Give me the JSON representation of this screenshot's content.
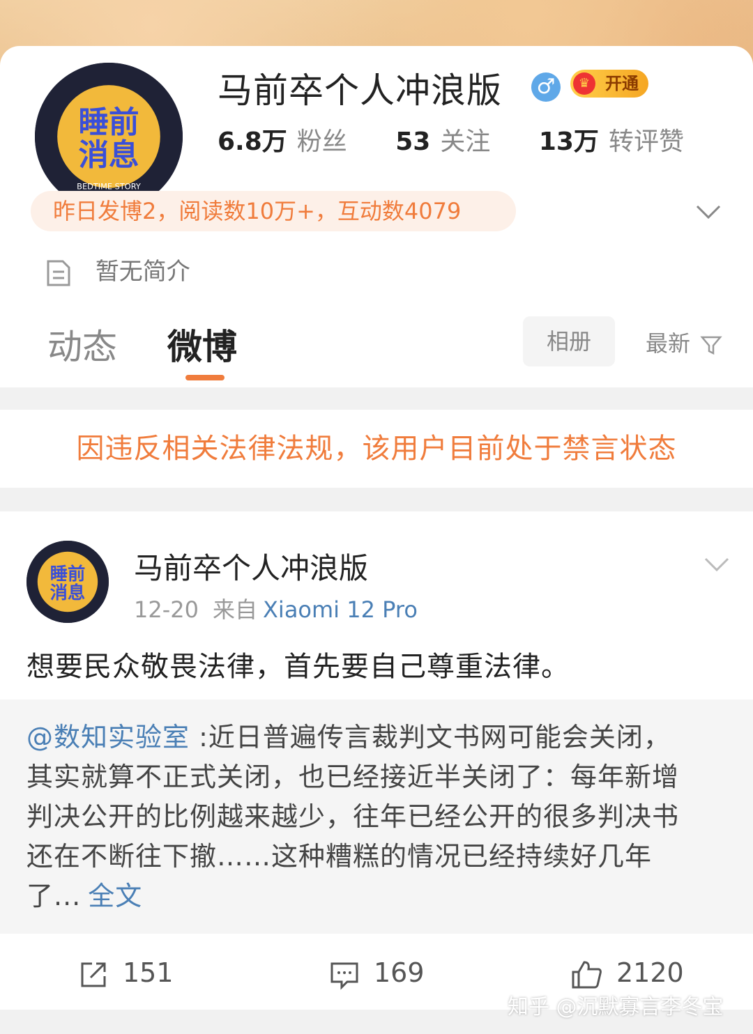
{
  "profile": {
    "username": "马前卒个人冲浪版",
    "gender_symbol": "♂",
    "vip_label": "开通",
    "avatar_text_line1": "睡前",
    "avatar_text_line2": "消息",
    "avatar_subtext": "BEDTIME STORY",
    "stats": [
      {
        "value": "6.8万",
        "label": "粉丝"
      },
      {
        "value": "53",
        "label": "关注"
      },
      {
        "value": "13万",
        "label": "转评赞"
      }
    ],
    "activity_summary": "昨日发博2，阅读数10万+，互动数4079",
    "bio": "暂无简介"
  },
  "tabs": [
    {
      "label": "动态",
      "active": false
    },
    {
      "label": "微博",
      "active": true
    }
  ],
  "toolbar": {
    "album_label": "相册",
    "sort_label": "最新"
  },
  "notice": "因违反相关法律法规，该用户目前处于禁言状态",
  "post": {
    "author": "马前卒个人冲浪版",
    "date": "12-20",
    "source_prefix": "来自",
    "device": "Xiaomi 12 Pro",
    "text": "想要民众敬畏法律，首先要自己尊重法律。",
    "repost": {
      "mention": "@数知实验室",
      "line1": " :近日普遍传言裁判文书网可能会关闭，",
      "line2": "其实就算不正式关闭，也已经接近半关闭了：每年新增",
      "line3": "判决公开的比例越来越少，往年已经公开的很多判决书",
      "line4": "还在不断往下撤……这种糟糕的情况已经持续好几年",
      "line5": "了...",
      "full_text_link": "全文"
    },
    "actions": {
      "repost_count": "151",
      "comment_count": "169",
      "like_count": "2120"
    }
  },
  "watermark": "知乎 @沉默寡言李冬宝",
  "colors": {
    "accent_orange": "#f07c3c",
    "link_blue": "#4a7fb5"
  },
  "icons": [
    "gender-male-icon",
    "vip-crown-icon",
    "chevron-down-icon",
    "document-icon",
    "filter-icon",
    "repost-icon",
    "comment-icon",
    "like-icon"
  ]
}
